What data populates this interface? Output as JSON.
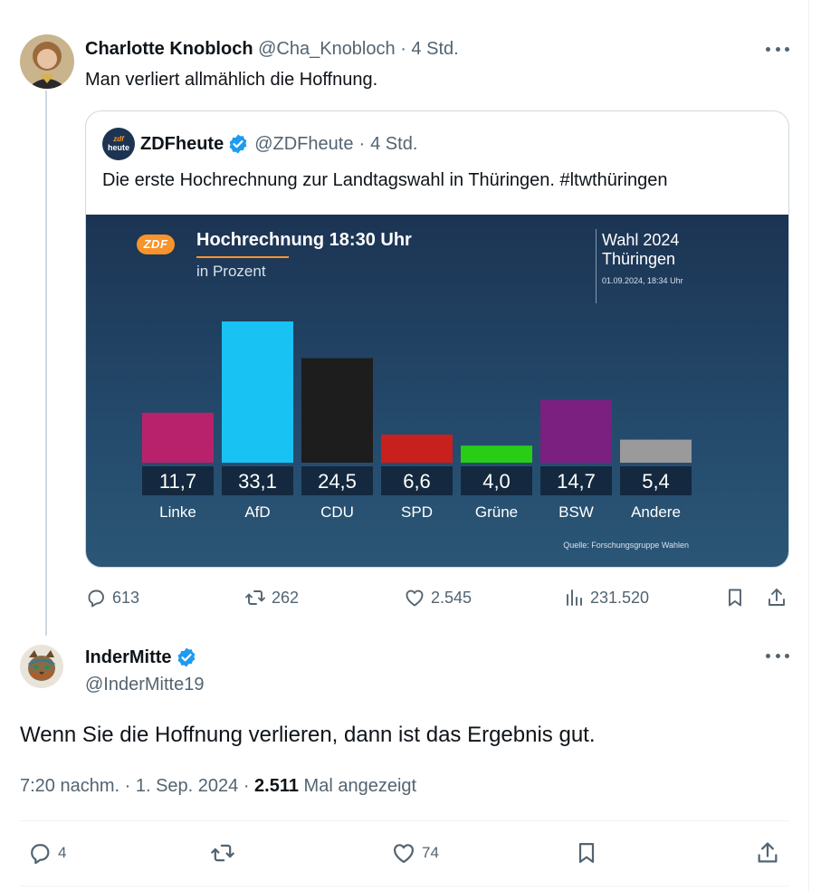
{
  "tweet1": {
    "author_name": "Charlotte Knobloch",
    "author_handle": "@Cha_Knobloch",
    "time": "4 Std.",
    "text": "Man verliert allmählich die Hoffnung.",
    "quote": {
      "logo_top": "zdf",
      "logo_bottom": "heute",
      "author_name": "ZDFheute",
      "author_handle": "@ZDFheute",
      "time": "4 Std.",
      "text": "Die erste Hochrechnung zur Landtagswahl in Thüringen. #ltwthüringen",
      "image": {
        "logo": "ZDF",
        "title": "Hochrechnung 18:30 Uhr",
        "subtitle": "in Prozent",
        "right_title_1": "Wahl 2024",
        "right_title_2": "Thüringen",
        "date": "01.09.2024, 18:34 Uhr",
        "source": "Quelle: Forschungsgruppe Wahlen"
      }
    },
    "actions": {
      "replies": "613",
      "reposts": "262",
      "likes": "2.545",
      "views": "231.520"
    }
  },
  "tweet2": {
    "author_name": "InderMitte",
    "author_handle": "@InderMitte19",
    "text": "Wenn Sie die Hoffnung verlieren, dann ist das Ergebnis gut.",
    "timestamp": "7:20 nachm. · 1. Sep. 2024 · ",
    "views_count": "2.511",
    "views_label": " Mal angezeigt",
    "actions": {
      "replies": "4",
      "likes": "74"
    }
  },
  "icons": [
    "more-icon",
    "verified-icon",
    "reply-icon",
    "repost-icon",
    "like-icon",
    "views-icon",
    "bookmark-icon",
    "share-icon"
  ],
  "colors": {
    "verified": "#1d9bf0",
    "text": "#0f1419",
    "muted": "#536471",
    "zdf_orange": "#f7942b"
  },
  "chart_data": {
    "type": "bar",
    "title": "Hochrechnung 18:30 Uhr",
    "subtitle": "in Prozent",
    "categories": [
      "Linke",
      "AfD",
      "CDU",
      "SPD",
      "Grüne",
      "BSW",
      "Andere"
    ],
    "values": [
      11.7,
      33.1,
      24.5,
      6.6,
      4.0,
      14.7,
      5.4
    ],
    "value_labels": [
      "11,7",
      "33,1",
      "24,5",
      "6,6",
      "4,0",
      "14,7",
      "5,4"
    ],
    "colors": [
      "#b8226d",
      "#18c3f3",
      "#1d1d1d",
      "#c8201d",
      "#29cd15",
      "#7b2080",
      "#9a9a9a"
    ],
    "ylim": [
      0,
      33.1
    ],
    "grid": false,
    "legend": "none"
  }
}
